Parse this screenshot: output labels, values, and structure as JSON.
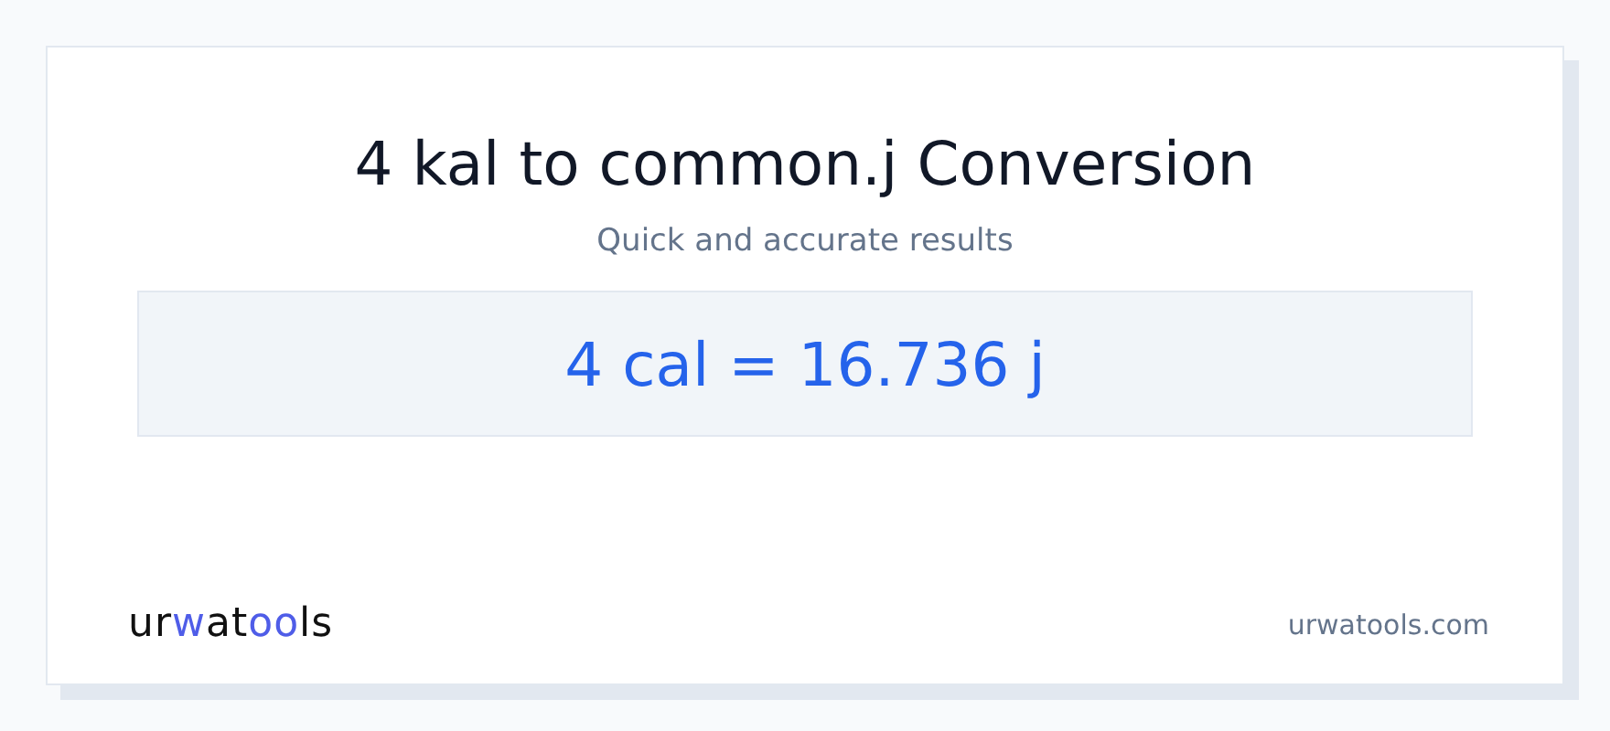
{
  "title": "4 kal to common.j Conversion",
  "subtitle": "Quick and accurate results",
  "result": "4 cal = 16.736 j",
  "logo": [
    {
      "text": "ur",
      "accent": false
    },
    {
      "text": "w",
      "accent": true
    },
    {
      "text": "at",
      "accent": false
    },
    {
      "text": "oo",
      "accent": true
    },
    {
      "text": "ls",
      "accent": false
    }
  ],
  "site": "urwatools.com"
}
